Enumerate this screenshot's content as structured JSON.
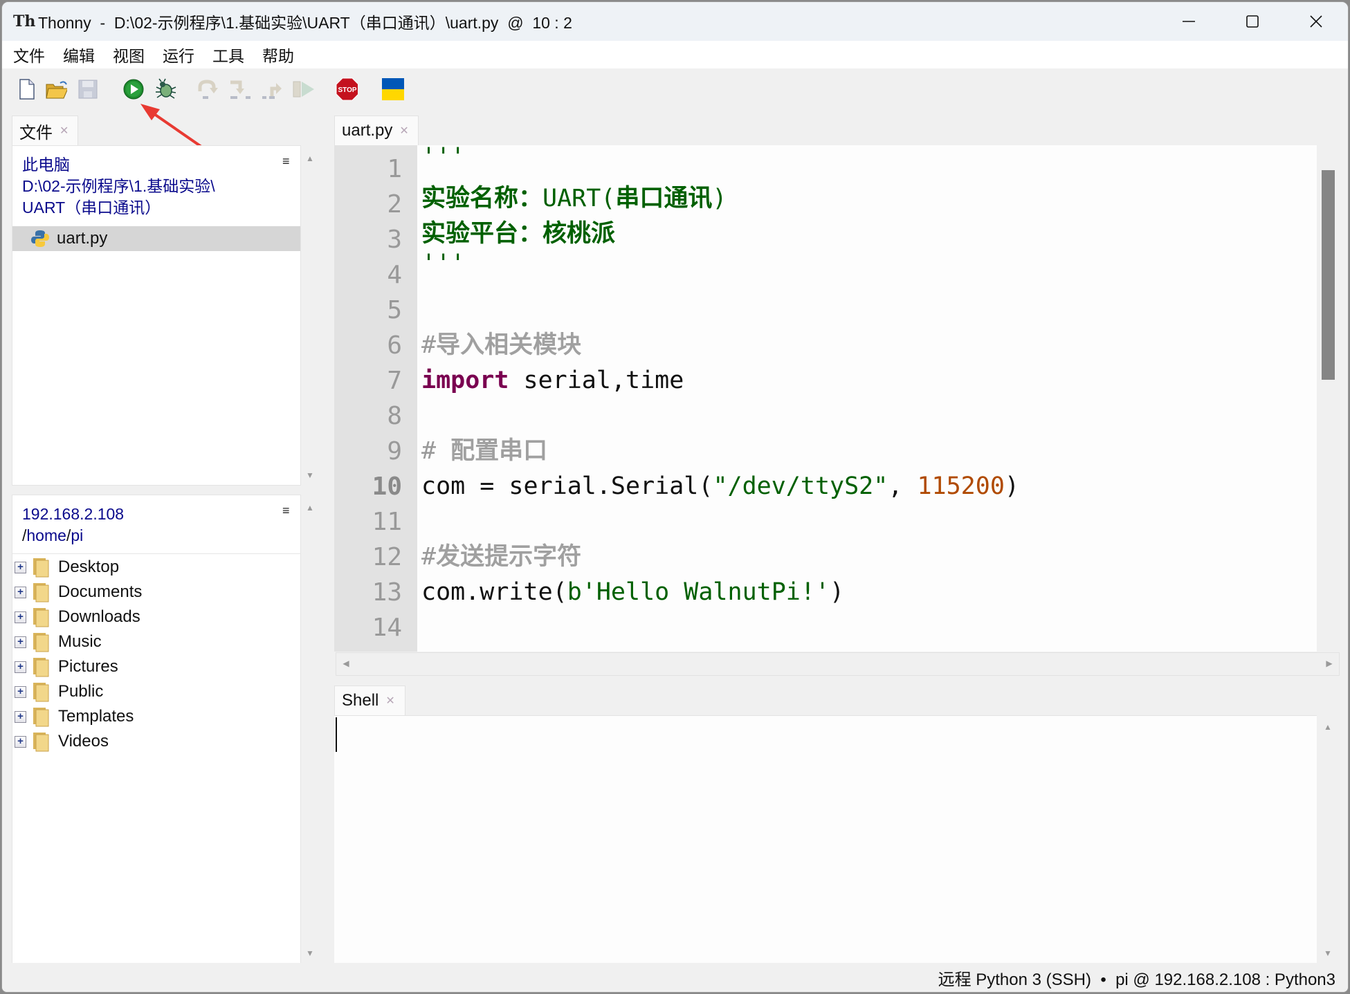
{
  "window": {
    "app_name": "Thonny",
    "title": "Thonny  -  D:\\02-示例程序\\1.基础实验\\UART（串口通讯）\\uart.py  @  10 : 2",
    "controls": {
      "minimize": "minimize",
      "maximize": "maximize",
      "close": "close"
    }
  },
  "menu": {
    "items": [
      "文件",
      "编辑",
      "视图",
      "运行",
      "工具",
      "帮助"
    ]
  },
  "toolbar": {
    "buttons": [
      {
        "name": "new-file",
        "icon": "new-file-icon",
        "enabled": true
      },
      {
        "name": "open-file",
        "icon": "open-folder-icon",
        "enabled": true
      },
      {
        "name": "save-file",
        "icon": "save-icon",
        "enabled": false
      },
      {
        "name": "run",
        "icon": "run-icon",
        "enabled": true
      },
      {
        "name": "debug",
        "icon": "bug-icon",
        "enabled": true
      },
      {
        "name": "step-over",
        "icon": "step-over-icon",
        "enabled": false
      },
      {
        "name": "step-into",
        "icon": "step-into-icon",
        "enabled": false
      },
      {
        "name": "step-out",
        "icon": "step-out-icon",
        "enabled": false
      },
      {
        "name": "resume",
        "icon": "resume-icon",
        "enabled": false
      },
      {
        "name": "stop",
        "icon": "stop-icon",
        "label": "STOP",
        "enabled": true
      },
      {
        "name": "support-ukraine",
        "icon": "ukraine-flag-icon",
        "enabled": true
      }
    ],
    "colors": {
      "run": "#1e8a2e",
      "stop": "#c4121e",
      "flag_blue": "#0057b7",
      "flag_yellow": "#ffd700"
    }
  },
  "files_panel": {
    "tab_label": "文件",
    "local": {
      "header_lines": [
        "此电脑",
        "D:\\02-示例程序\\1.基础实验\\",
        "UART（串口通讯）"
      ],
      "files": [
        {
          "name": "uart.py",
          "icon": "python-file-icon",
          "selected": true
        }
      ]
    },
    "remote": {
      "host": "192.168.2.108",
      "path_parts": [
        "/",
        "home",
        "/",
        "pi"
      ],
      "folders": [
        "Desktop",
        "Documents",
        "Downloads",
        "Music",
        "Pictures",
        "Public",
        "Templates",
        "Videos"
      ]
    }
  },
  "editor": {
    "tab_label": "uart.py",
    "current_line": 10,
    "lines": [
      {
        "n": "1"
      },
      {
        "n": "2"
      },
      {
        "n": "3"
      },
      {
        "n": "4"
      },
      {
        "n": "5"
      },
      {
        "n": "6"
      },
      {
        "n": "7"
      },
      {
        "n": "8"
      },
      {
        "n": "9"
      },
      {
        "n": "10"
      },
      {
        "n": "11"
      },
      {
        "n": "12"
      },
      {
        "n": "13"
      },
      {
        "n": "14"
      }
    ],
    "code": {
      "l1": "'''",
      "l2a": "实验名称：",
      "l2b": "UART(",
      "l2c": "串口通讯",
      "l2d": ")",
      "l3": "实验平台：核桃派",
      "l4": "'''",
      "l6a": "#",
      "l6b": "导入相关模块",
      "l7a": "import",
      "l7b": " serial,time",
      "l9a": "# ",
      "l9b": "配置串口",
      "l10a": "com = serial.Serial(",
      "l10b": "\"/dev/ttyS2\"",
      "l10c": ", ",
      "l10d": "115200",
      "l10e": ")",
      "l12a": "#",
      "l12b": "发送提示字符",
      "l13a": "com.write(",
      "l13b": "b'Hello WalnutPi!'",
      "l13c": ")"
    },
    "syntax_colors": {
      "string": "#006000",
      "keyword": "#7a0050",
      "comment": "#9a9a9a",
      "number": "#b04a00"
    }
  },
  "shell": {
    "tab_label": "Shell",
    "content": ""
  },
  "statusbar": {
    "text": "远程 Python 3 (SSH)  •  pi @ 192.168.2.108 : Python3"
  }
}
